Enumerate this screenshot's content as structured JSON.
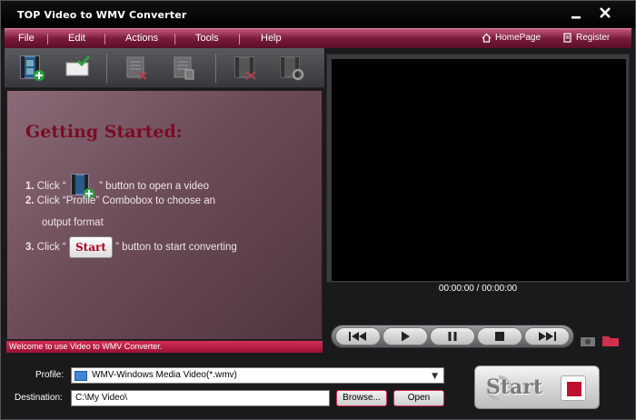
{
  "window": {
    "title": "TOP Video to WMV Converter"
  },
  "menu": {
    "items": [
      "File",
      "Edit",
      "Actions",
      "Tools",
      "Help"
    ],
    "homepage": "HomePage",
    "register": "Register"
  },
  "toolbar": {
    "icons": [
      "add-video-icon",
      "open-folder-check-icon",
      "remove-icon",
      "clear-icon",
      "cut-icon",
      "settings-icon"
    ]
  },
  "guide": {
    "title": "Getting Started:",
    "step1_num": "1.",
    "step1_pre": "Click “",
    "step1_post": "” button to open a video",
    "step2_num": "2.",
    "step2_line1": "Click “Profile” Combobox to choose an",
    "step2_line2": "output format",
    "step3_num": "3.",
    "step3_pre": "Click “",
    "step3_btn": "Start",
    "step3_post": "” button to start converting"
  },
  "status": {
    "text": "Welcome to use Video to WMV Converter."
  },
  "player": {
    "time": "00:00:00 / 00:00:00"
  },
  "bottom": {
    "profile_label": "Profile:",
    "profile_value": "WMV-Windows Media Video(*.wmv)",
    "destination_label": "Destination:",
    "destination_value": "C:\\My Video\\",
    "browse_label": "Browse...",
    "open_label": "Open",
    "start_label": "Start"
  },
  "colors": {
    "accent": "#9a1233",
    "title_red": "#7a0c24"
  }
}
